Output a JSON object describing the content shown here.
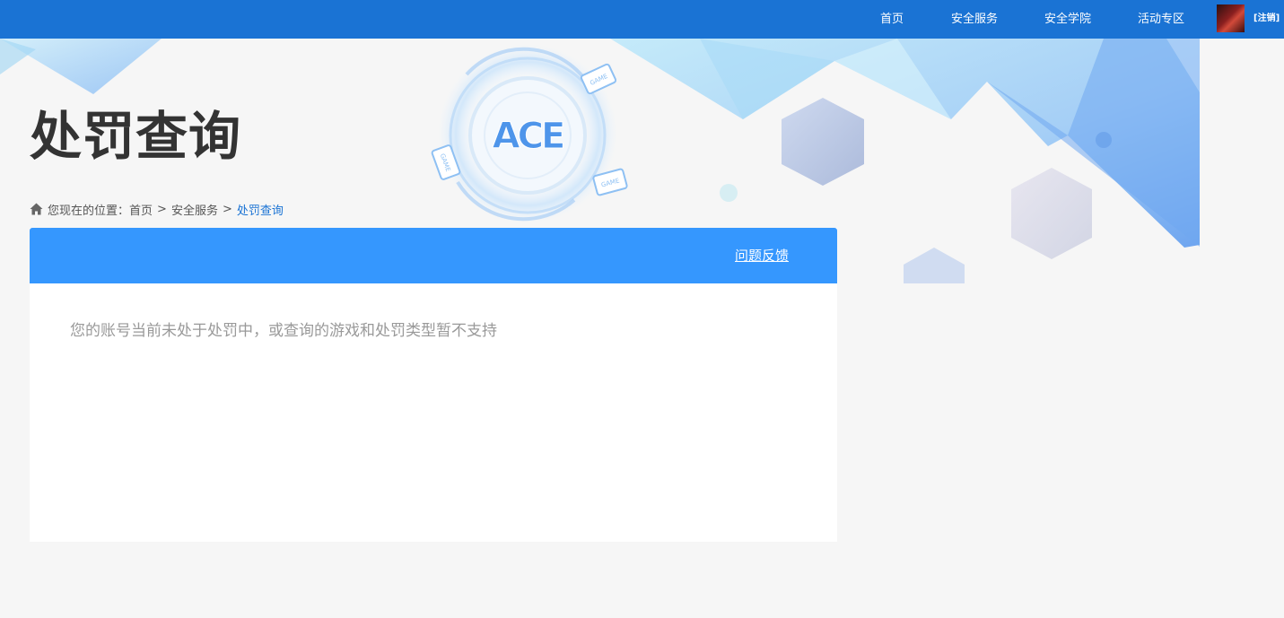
{
  "nav": {
    "items": [
      "首页",
      "安全服务",
      "安全学院",
      "活动专区"
    ],
    "logout_label": "[注销]"
  },
  "banner": {
    "logo_text": "ACE",
    "card_label": "GAME"
  },
  "page": {
    "title": "处罚查询"
  },
  "breadcrumb": {
    "prefix": "您现在的位置：",
    "home": "首页",
    "separator": ">",
    "section": "安全服务",
    "current": "处罚查询"
  },
  "panel": {
    "feedback_label": "问题反馈",
    "message": "您的账号当前未处于处罚中，或查询的游戏和处罚类型暂不支持"
  },
  "colors": {
    "topbar": "#1a73d4",
    "panel_header": "#3597fe",
    "page_background": "#f6f6f6",
    "current_crumb": "#1a73d4"
  }
}
